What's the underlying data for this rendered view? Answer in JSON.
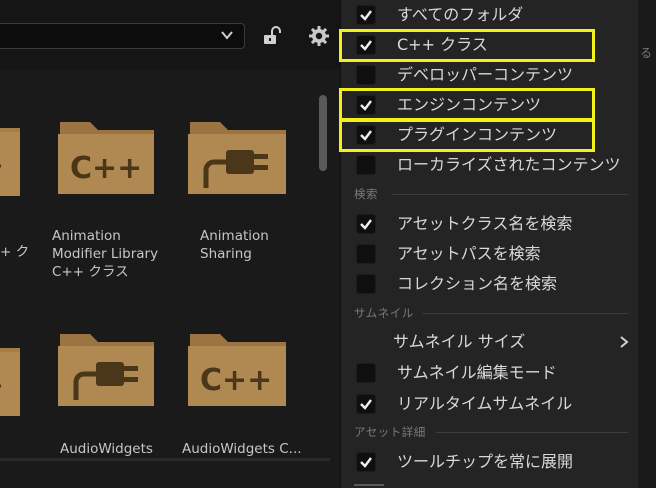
{
  "browser": {
    "tiles": [
      {
        "label": "+ ク",
        "icon": "cpp-folder-icon"
      },
      {
        "label": "Animation\nModifier Library\nC++ クラス",
        "icon": "cpp-folder-icon"
      },
      {
        "label": "Animation\nSharing",
        "icon": "plugin-folder-icon"
      },
      {
        "label": "",
        "icon": "cpp-folder-icon"
      },
      {
        "label": "AudioWidgets",
        "icon": "plugin-folder-icon"
      },
      {
        "label": "AudioWidgets C...",
        "icon": "cpp-folder-icon"
      }
    ]
  },
  "menu": {
    "items": [
      {
        "label": "すべてのフォルダ",
        "checked": true
      },
      {
        "label": "C++ クラス",
        "checked": true
      },
      {
        "label": "デベロッパーコンテンツ",
        "checked": false
      },
      {
        "label": "エンジンコンテンツ",
        "checked": true
      },
      {
        "label": "プラグインコンテンツ",
        "checked": true
      },
      {
        "label": "ローカライズされたコンテンツ",
        "checked": false
      },
      {
        "label": "アセットクラス名を検索",
        "checked": true
      },
      {
        "label": "アセットパスを検索",
        "checked": false
      },
      {
        "label": "コレクション名を検索",
        "checked": false
      },
      {
        "label": "サムネイル サイズ",
        "submenu": true
      },
      {
        "label": "サムネイル編集モード",
        "checked": false
      },
      {
        "label": "リアルタイムサムネイル",
        "checked": true
      },
      {
        "label": "ツールチップを常に展開",
        "checked": true
      }
    ],
    "sections": {
      "search": "検索",
      "thumbnail": "サムネイル",
      "asset_detail": "アセット詳細"
    }
  },
  "edge_text": "る",
  "colors": {
    "highlight": "#f2f21a",
    "folder": "#a57d46",
    "menu_bg": "#242424"
  }
}
